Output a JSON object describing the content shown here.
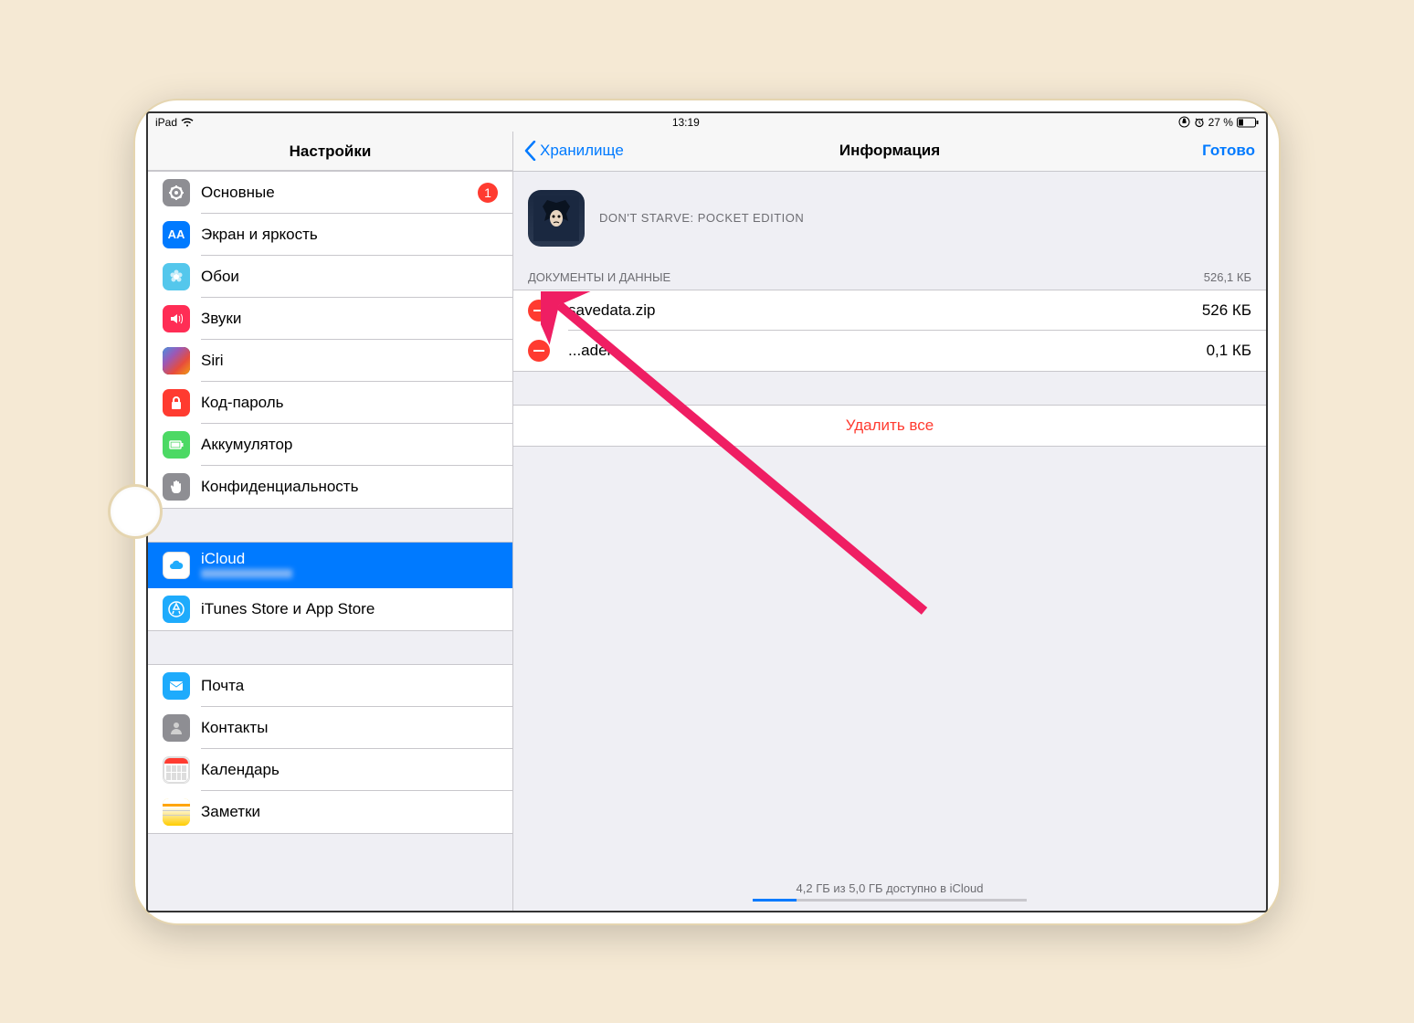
{
  "status": {
    "device": "iPad",
    "time": "13:19",
    "battery": "27 %"
  },
  "sidebar": {
    "title": "Настройки",
    "g1": [
      {
        "label": "Основные",
        "badge": "1",
        "icon": "gear",
        "bg": "#8e8e93"
      },
      {
        "label": "Экран и яркость",
        "icon": "aa",
        "bg": "#007aff"
      },
      {
        "label": "Обои",
        "icon": "flower",
        "bg": "#54c7ec"
      },
      {
        "label": "Звуки",
        "icon": "speaker",
        "bg": "#ff2d55"
      },
      {
        "label": "Siri",
        "icon": "siri",
        "bg": "#000"
      },
      {
        "label": "Код-пароль",
        "icon": "lock",
        "bg": "#ff3b30"
      },
      {
        "label": "Аккумулятор",
        "icon": "battery",
        "bg": "#4cd964"
      },
      {
        "label": "Конфиденциальность",
        "icon": "hand",
        "bg": "#8e8e93"
      }
    ],
    "g2": [
      {
        "label": "iCloud",
        "icon": "cloud",
        "bg": "#fff",
        "selected": true
      },
      {
        "label": "iTunes Store и App Store",
        "icon": "appstore",
        "bg": "#1eabfc"
      }
    ],
    "g3": [
      {
        "label": "Почта",
        "icon": "mail",
        "bg": "#1eabfc"
      },
      {
        "label": "Контакты",
        "icon": "contacts",
        "bg": "#8e8e93"
      },
      {
        "label": "Календарь",
        "icon": "calendar",
        "bg": "#fff"
      },
      {
        "label": "Заметки",
        "icon": "notes",
        "bg": "#ffcc00"
      }
    ]
  },
  "nav": {
    "back": "Хранилище",
    "title": "Информация",
    "done": "Готово"
  },
  "app": {
    "name": "DON'T STARVE: POCKET EDITION"
  },
  "docs": {
    "header": "ДОКУМЕНТЫ И ДАННЫЕ",
    "total": "526,1 КБ",
    "items": [
      {
        "name": "savedata.zip",
        "size": "526 КБ"
      },
      {
        "name": "...ader",
        "size": "0,1 КБ"
      }
    ]
  },
  "deleteAll": "Удалить все",
  "storage": {
    "text": "4,2 ГБ из 5,0 ГБ доступно в iCloud"
  }
}
